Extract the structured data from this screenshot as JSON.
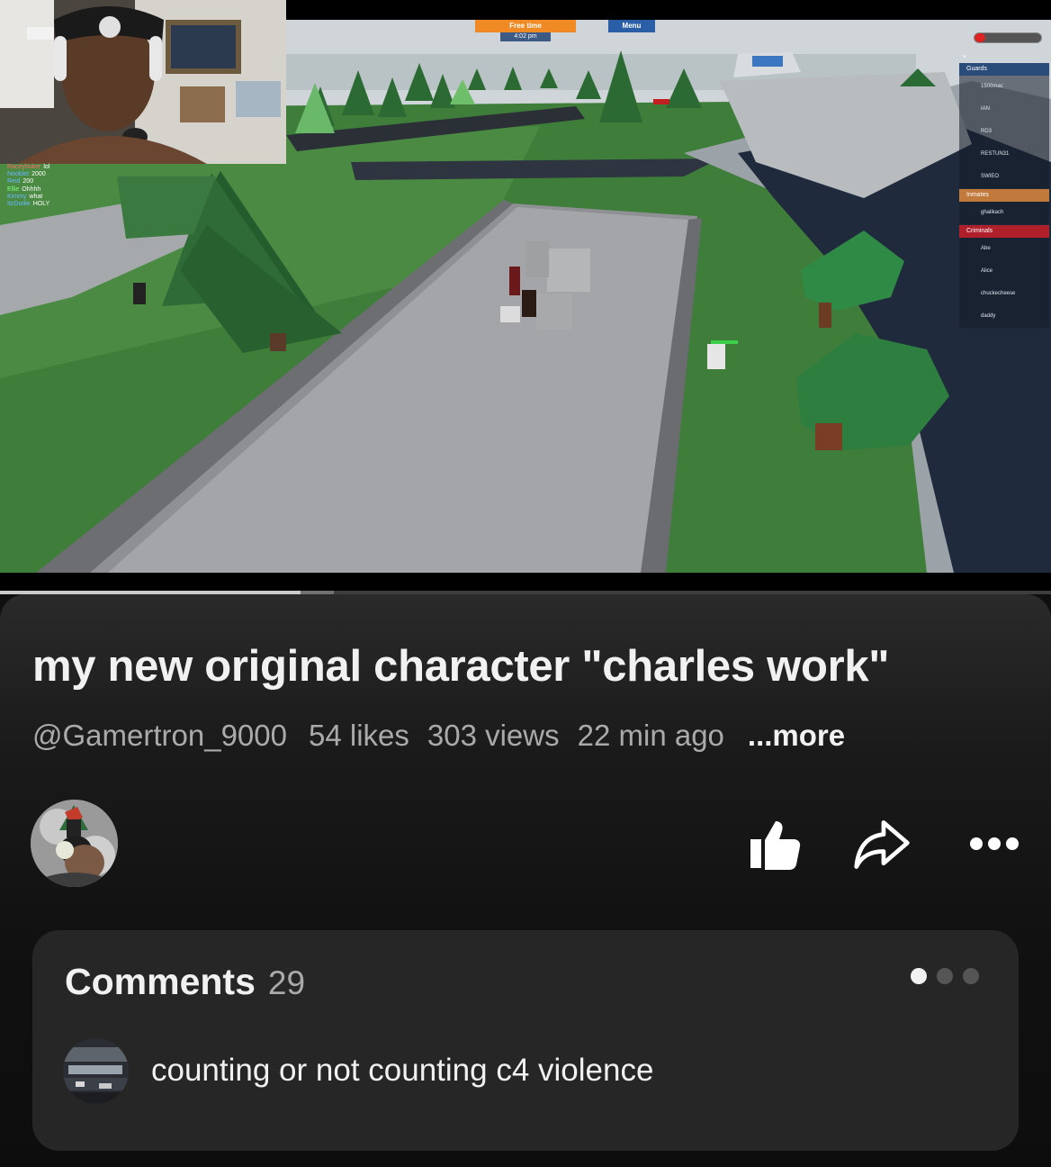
{
  "video": {
    "hud": {
      "free_time": "Free time",
      "clock": "4:02 pm",
      "menu": "Menu",
      "health_fraction": 0.16
    },
    "chat": [
      {
        "name": "Raceyhuker",
        "text": "lol"
      },
      {
        "name": "Nooblet",
        "text": "2000"
      },
      {
        "name": "Reid",
        "text": "200"
      },
      {
        "name": "Ellie",
        "text": "Ohhhh"
      },
      {
        "name": "Kimmy",
        "text": "what"
      },
      {
        "name": "ItzDodie",
        "text": "HOLY"
      }
    ],
    "player_list": {
      "close": "×",
      "teams": [
        {
          "name": "Guards",
          "players": [
            "1500mac",
            "IAN",
            "RD3",
            "RESTUN31",
            "SWIEO"
          ]
        },
        {
          "name": "Inmates",
          "players": [
            "ghalikach"
          ]
        },
        {
          "name": "Criminals",
          "players": [
            "Abe",
            "Alice",
            "chuckecheese",
            "daddy"
          ]
        }
      ]
    },
    "progress": {
      "played_fraction": 0.286,
      "buffered_fraction": 0.032
    }
  },
  "info": {
    "title": "my new original character \"charles work\"",
    "handle": "@Gamertron_9000",
    "likes": "54 likes",
    "views": "303 views",
    "age": "22 min ago",
    "more": "...more"
  },
  "actions": {
    "like_icon": "thumbs-up-icon",
    "share_icon": "share-arrow-icon",
    "more_icon": "more-dots-icon"
  },
  "comments": {
    "title": "Comments",
    "count": "29",
    "pages": 3,
    "active_page": 0,
    "top_comment": "counting or not counting c4 violence"
  },
  "colors": {
    "background": "#0f0f0f",
    "card": "#262626",
    "text_primary": "#f1f1f1",
    "text_secondary": "#aaaaaa",
    "hud_orange": "#f08a24",
    "hud_blue": "#2a5fa8",
    "health_red": "#dd2222"
  }
}
